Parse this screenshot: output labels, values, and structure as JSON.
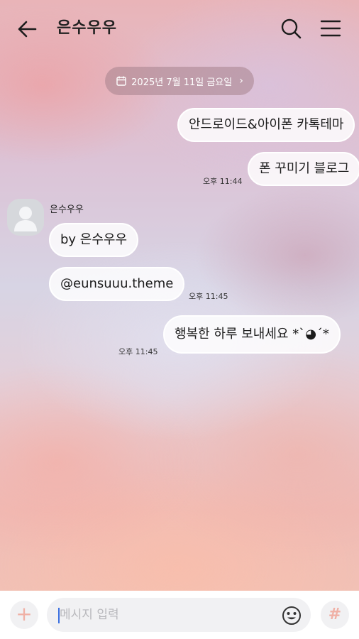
{
  "header": {
    "title": "은수우우",
    "icons": {
      "back": "back-arrow-icon",
      "search": "search-icon",
      "menu": "hamburger-menu-icon"
    }
  },
  "date_divider": {
    "label": "2025년 7월 11일 금요일",
    "chevron": "›"
  },
  "messages": [
    {
      "side": "right",
      "text": "안드로이드&아이폰 카톡테마"
    },
    {
      "side": "right",
      "text": "폰 꾸미기 블로그",
      "time": "오후 11:44"
    },
    {
      "side": "left",
      "sender": "은수우우",
      "text": "by 은수우우"
    },
    {
      "side": "left",
      "text": "@eunsuuu.theme",
      "time": "오후 11:45"
    },
    {
      "side": "right",
      "text": "행복한 하루 보내세요 *ˋ◕ˊ*",
      "time": "오후 11:45"
    }
  ],
  "input_bar": {
    "placeholder": "메시지 입력",
    "plus_label": "+",
    "hash_label": "#"
  },
  "colors": {
    "accent": "#f0b0a5",
    "bubble_bg": "#ffffff",
    "date_chip": "#a5828c"
  }
}
